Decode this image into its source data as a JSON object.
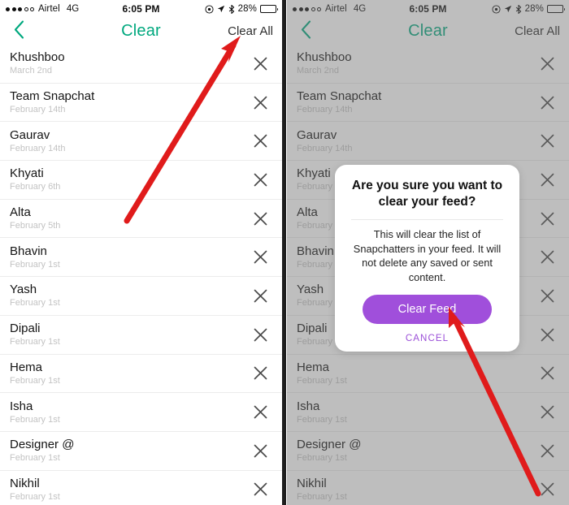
{
  "status_bar": {
    "carrier": "Airtel",
    "network": "4G",
    "time": "6:05 PM",
    "battery_percent": "28%",
    "signal_dots_filled": 3,
    "signal_dots_total": 5,
    "icons": [
      "alarm-target-icon",
      "location-arrow-icon",
      "bluetooth-icon",
      "battery-icon"
    ]
  },
  "nav": {
    "back_icon": "chevron-left-icon",
    "title": "Clear",
    "action_label": "Clear All",
    "title_color": "#00a87e"
  },
  "list": {
    "remove_icon": "close-x-icon",
    "items": [
      {
        "name": "Khushboo",
        "date": "March 2nd"
      },
      {
        "name": "Team Snapchat",
        "date": "February 14th"
      },
      {
        "name": "Gaurav",
        "date": "February 14th"
      },
      {
        "name": "Khyati",
        "date": "February 6th"
      },
      {
        "name": "Alta",
        "date": "February 5th"
      },
      {
        "name": "Bhavin",
        "date": "February 1st"
      },
      {
        "name": "Yash",
        "date": "February 1st"
      },
      {
        "name": "Dipali",
        "date": "February 1st"
      },
      {
        "name": "Hema",
        "date": "February 1st"
      },
      {
        "name": "Isha",
        "date": "February 1st"
      },
      {
        "name": "Designer @",
        "date": "February 1st"
      },
      {
        "name": "Nikhil",
        "date": "February 1st"
      }
    ]
  },
  "dialog": {
    "title": "Are you sure you want to clear your feed?",
    "body": "This will clear the list of Snapchatters in your feed. It will not delete any saved or sent content.",
    "confirm_label": "Clear Feed",
    "cancel_label": "CANCEL",
    "confirm_color": "#a04fdb",
    "cancel_color": "#9b4fd8"
  },
  "annotations": {
    "arrow_color": "#e01b1b",
    "arrow_left_target": "Clear All",
    "arrow_right_target": "Clear Feed"
  }
}
